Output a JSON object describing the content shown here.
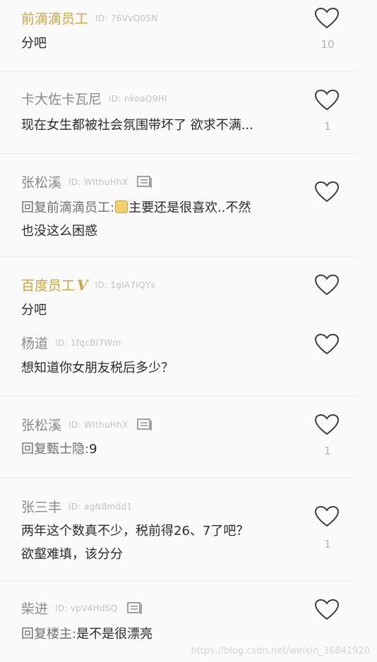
{
  "comments": [
    {
      "name": "前滴滴员工",
      "uid": "ID: 76VvQ05N",
      "text": "分吧",
      "likes": "10"
    },
    {
      "name": "卡大佐卡瓦尼",
      "uid": "ID: nkoaQ9HI",
      "text": "现在女生都被社会氛围带坏了 欲求不满...",
      "likes": "1"
    },
    {
      "name": "张松溪",
      "uid": "ID: WIthuHhX",
      "reply_prefix": "回复前滴滴员工:",
      "text_line1": "主要还是很喜欢..不然",
      "text_line2": "也没这么困惑",
      "likes": ""
    },
    {
      "name": "百度员工",
      "badge": "V",
      "uid": "ID: 1glA7IQYs",
      "text": "分吧",
      "likes": ""
    },
    {
      "name": "杨道",
      "uid": "ID: 1fqcBI7Wm",
      "text": "想知道你女朋友税后多少？",
      "likes": ""
    },
    {
      "name": "张松溪",
      "uid": "ID: WIthuHhX",
      "reply_prefix": "回复甄士隐:",
      "text": "9",
      "likes": "1"
    },
    {
      "name": "张三丰",
      "uid": "ID: agN8mdd1",
      "text_line1": "两年这个数真不少，税前得26、7了吧？",
      "text_line2": "欲壑难填，该分分",
      "likes": "1"
    },
    {
      "name": "柴进",
      "uid": "ID: vpV4HdSQ",
      "reply_prefix": "回复楼主:",
      "text": "是不是很漂亮",
      "likes": ""
    }
  ],
  "watermark": "https://blog.csdn.net/weixin_36841920",
  "colors": {
    "gold_name": "#c9a640",
    "gray_name": "#8a8a8a",
    "heart": "#3c3c3c"
  }
}
